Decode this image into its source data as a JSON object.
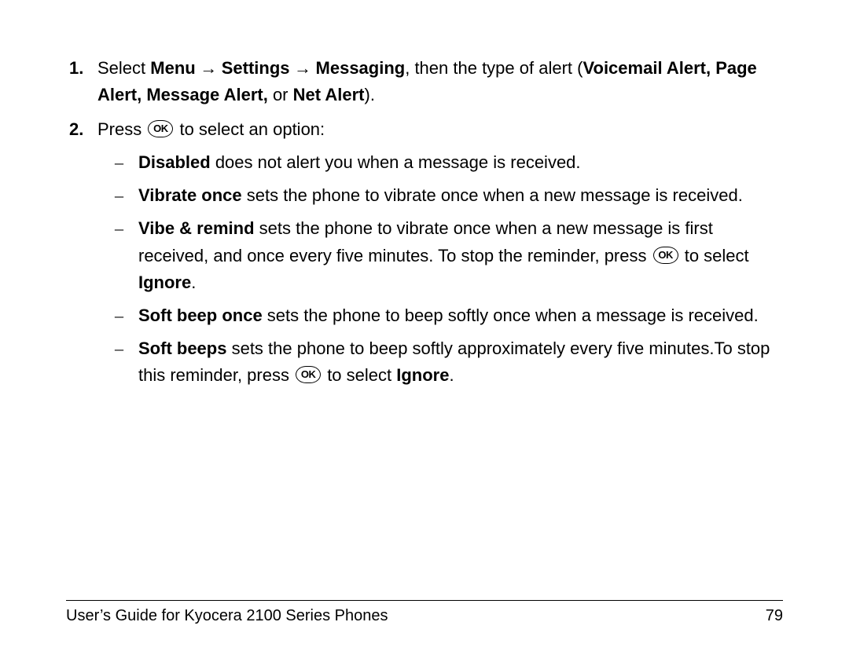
{
  "list": {
    "item1": {
      "marker": "1.",
      "pre": "Select ",
      "nav1": "Menu",
      "arrow": " → ",
      "nav2": "Settings",
      "nav3": "Messaging",
      "mid": ", then the type of alert (",
      "alerts": "Voicemail Alert, Page Alert, Message Alert,",
      "or": " or ",
      "net": "Net Alert",
      "end": ")."
    },
    "item2": {
      "marker": "2.",
      "pre": "Press ",
      "ok_label": "OK",
      "post": " to select an option:"
    }
  },
  "sub": {
    "dash": "–",
    "a": {
      "term": "Disabled",
      "rest": " does not alert you when a message is received."
    },
    "b": {
      "term": "Vibrate once",
      "rest": " sets the phone to vibrate once when a new message is received."
    },
    "c": {
      "term": "Vibe & remind",
      "rest1": " sets the phone to vibrate once when a new message is first received, and once every five minutes. To stop the reminder, press ",
      "rest2": " to select ",
      "ignore": "Ignore",
      "period": "."
    },
    "d": {
      "term": "Soft beep once",
      "rest": " sets the phone to beep softly once when a message is received."
    },
    "e": {
      "term": "Soft beeps",
      "rest1": " sets the phone to beep softly approximately every five minutes.To stop this reminder, press ",
      "rest2": " to select ",
      "ignore": "Ignore",
      "period": "."
    }
  },
  "footer": {
    "title": "User’s Guide for Kyocera 2100 Series Phones",
    "page": "79"
  }
}
